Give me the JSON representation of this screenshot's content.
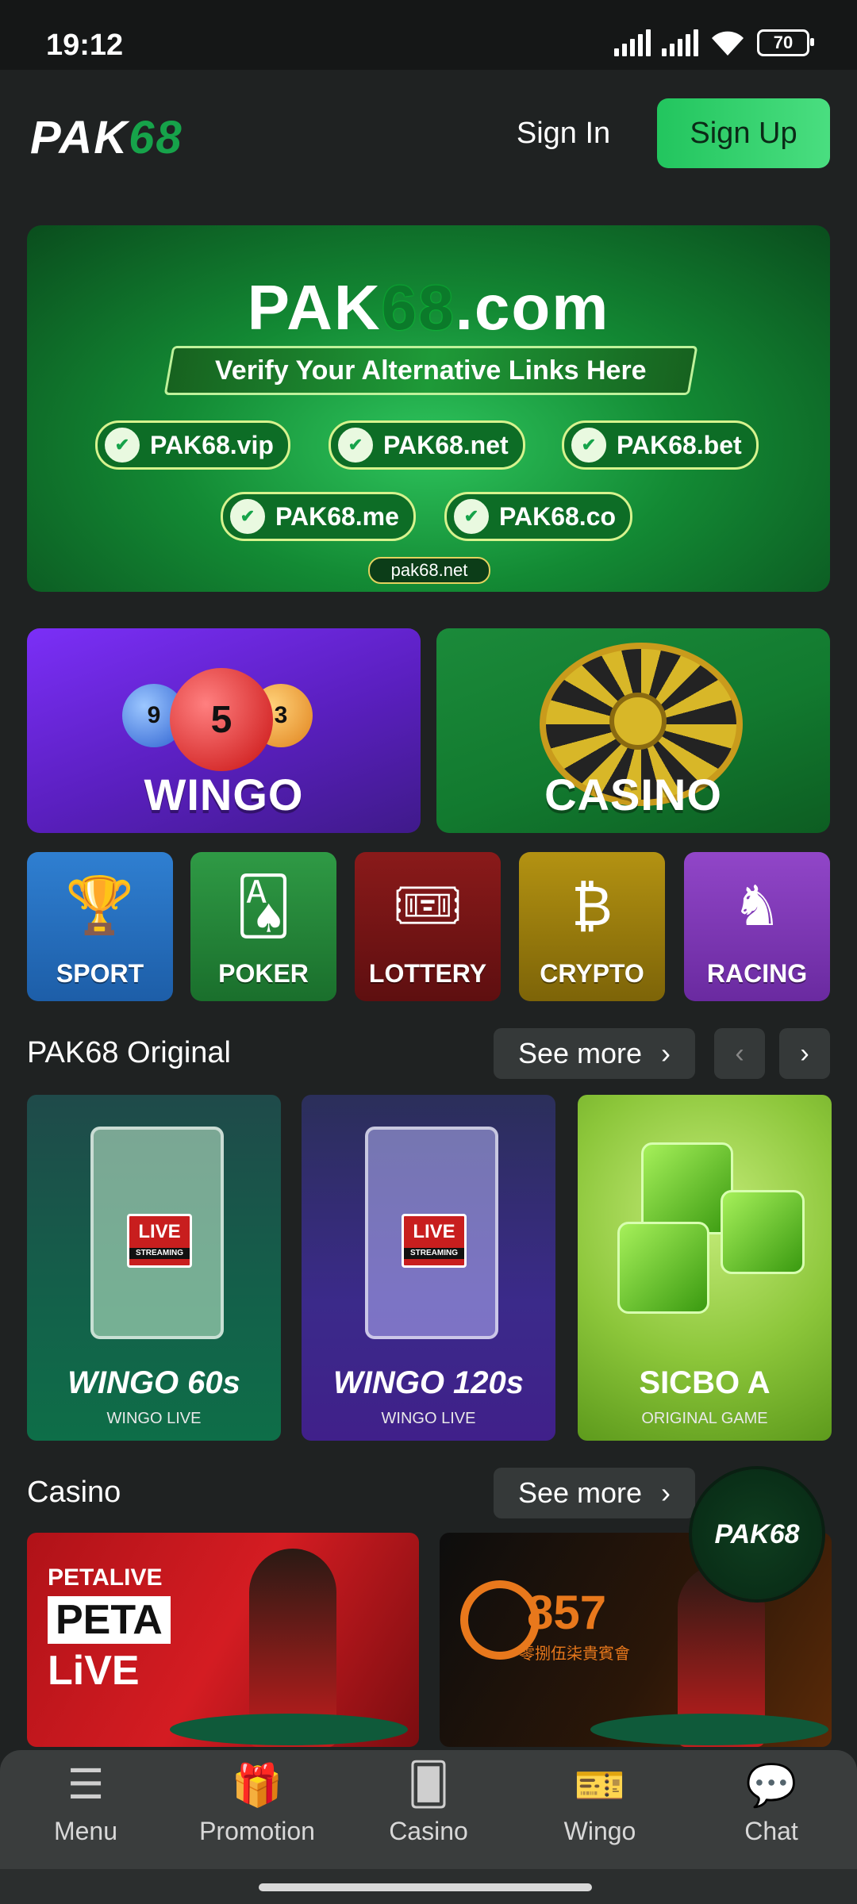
{
  "status_bar": {
    "time": "19:12",
    "battery": "70"
  },
  "header": {
    "logo_left": "PAK",
    "logo_right": "68",
    "sign_in": "Sign In",
    "sign_up": "Sign Up"
  },
  "banner": {
    "title_left": "PAK",
    "title_mid": "68",
    "title_right": ".com",
    "subtitle": "Verify Your Alternative Links Here",
    "links": [
      "PAK68.vip",
      "PAK68.net",
      "PAK68.bet",
      "PAK68.me",
      "PAK68.co"
    ],
    "footer": "pak68.net"
  },
  "categories_large": [
    {
      "label": "WINGO"
    },
    {
      "label": "CASINO"
    }
  ],
  "categories_small": [
    {
      "label": "SPORT",
      "icon": "trophy-icon"
    },
    {
      "label": "POKER",
      "icon": "cards-icon"
    },
    {
      "label": "LOTTERY",
      "icon": "ticket-icon"
    },
    {
      "label": "CRYPTO",
      "icon": "bitcoin-icon"
    },
    {
      "label": "RACING",
      "icon": "horse-icon"
    }
  ],
  "original_section": {
    "title": "PAK68 Original",
    "see_more": "See more",
    "games": [
      {
        "name": "WINGO 60s",
        "sub": "WINGO LIVE",
        "live": "LIVE",
        "streaming": "STREAMING"
      },
      {
        "name": "WINGO 120s",
        "sub": "WINGO LIVE",
        "live": "LIVE",
        "streaming": "STREAMING"
      },
      {
        "name": "SICBO A",
        "sub": "ORIGINAL GAME"
      }
    ]
  },
  "casino_section": {
    "title": "Casino",
    "see_more": "See more",
    "tiles": [
      {
        "brand_top": "PETALIVE",
        "brand_main": "PETA",
        "brand_sub": "LiVE"
      },
      {
        "brand_main": "857",
        "brand_sub": "零捌伍柒貴賓會"
      }
    ]
  },
  "fab": {
    "label": "PAK68"
  },
  "bottom_nav": [
    {
      "label": "Menu",
      "icon": "menu-icon"
    },
    {
      "label": "Promotion",
      "icon": "gift-icon"
    },
    {
      "label": "Casino",
      "icon": "cards-icon"
    },
    {
      "label": "Wingo",
      "icon": "ticket-icon"
    },
    {
      "label": "Chat",
      "icon": "chat-icon"
    }
  ],
  "colors": {
    "accent": "#22c55e",
    "background": "#1f2222",
    "nav": "#3a3d3d"
  }
}
